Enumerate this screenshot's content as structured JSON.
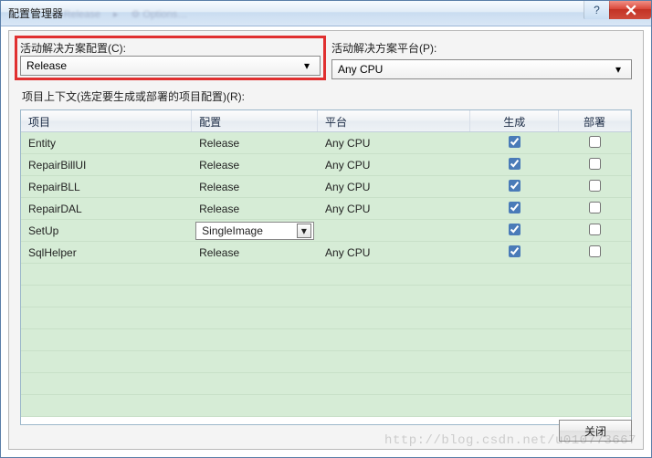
{
  "window": {
    "title": "配置管理器"
  },
  "config": {
    "solution_config_label": "活动解决方案配置(C):",
    "solution_config_value": "Release",
    "solution_platform_label": "活动解决方案平台(P):",
    "solution_platform_value": "Any CPU"
  },
  "context_label": "项目上下文(选定要生成或部署的项目配置)(R):",
  "columns": {
    "c0": "项目",
    "c1": "配置",
    "c2": "平台",
    "c3": "生成",
    "c4": "部署"
  },
  "rows": [
    {
      "project": "Entity",
      "config": "Release",
      "platform": "Any CPU",
      "build": true,
      "deploy": false,
      "show_dropdown": false
    },
    {
      "project": "RepairBillUI",
      "config": "Release",
      "platform": "Any CPU",
      "build": true,
      "deploy": false,
      "show_dropdown": false
    },
    {
      "project": "RepairBLL",
      "config": "Release",
      "platform": "Any CPU",
      "build": true,
      "deploy": false,
      "show_dropdown": false
    },
    {
      "project": "RepairDAL",
      "config": "Release",
      "platform": "Any CPU",
      "build": true,
      "deploy": false,
      "show_dropdown": false
    },
    {
      "project": "SetUp",
      "config": "SingleImage",
      "platform": "",
      "build": true,
      "deploy": false,
      "show_dropdown": true
    },
    {
      "project": "SqlHelper",
      "config": "Release",
      "platform": "Any CPU",
      "build": true,
      "deploy": false,
      "show_dropdown": false
    }
  ],
  "footer": {
    "close_label": "关闭"
  },
  "watermark": "http://blog.csdn.net/u010773667"
}
